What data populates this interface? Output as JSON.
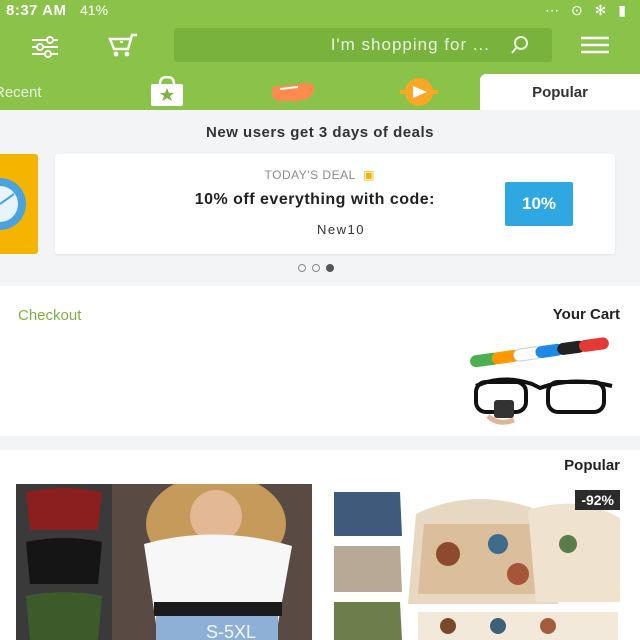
{
  "status_bar": {
    "time": "8:37 AM",
    "battery": "41%"
  },
  "search": {
    "placeholder": "I'm shopping for ..."
  },
  "tabs": [
    {
      "label": "Popular",
      "icon": "star-badge-icon"
    },
    {
      "label": "Recent",
      "icon": "bag-icon"
    }
  ],
  "promo": {
    "title": "New users get 3 days of deals",
    "deal_tag": "TODAY'S DEAL",
    "deal_text": "10% off everything with code:",
    "deal_code": "New10",
    "coupon_label": "10%"
  },
  "cart": {
    "title": "Your Cart",
    "checkout_label": "Checkout"
  },
  "popular": {
    "title": "Popular",
    "discount_badge": "-92%"
  },
  "colors": {
    "brand_green": "#8bc34a",
    "accent_blue": "#2fa7e0",
    "accent_yellow": "#f4b400"
  }
}
